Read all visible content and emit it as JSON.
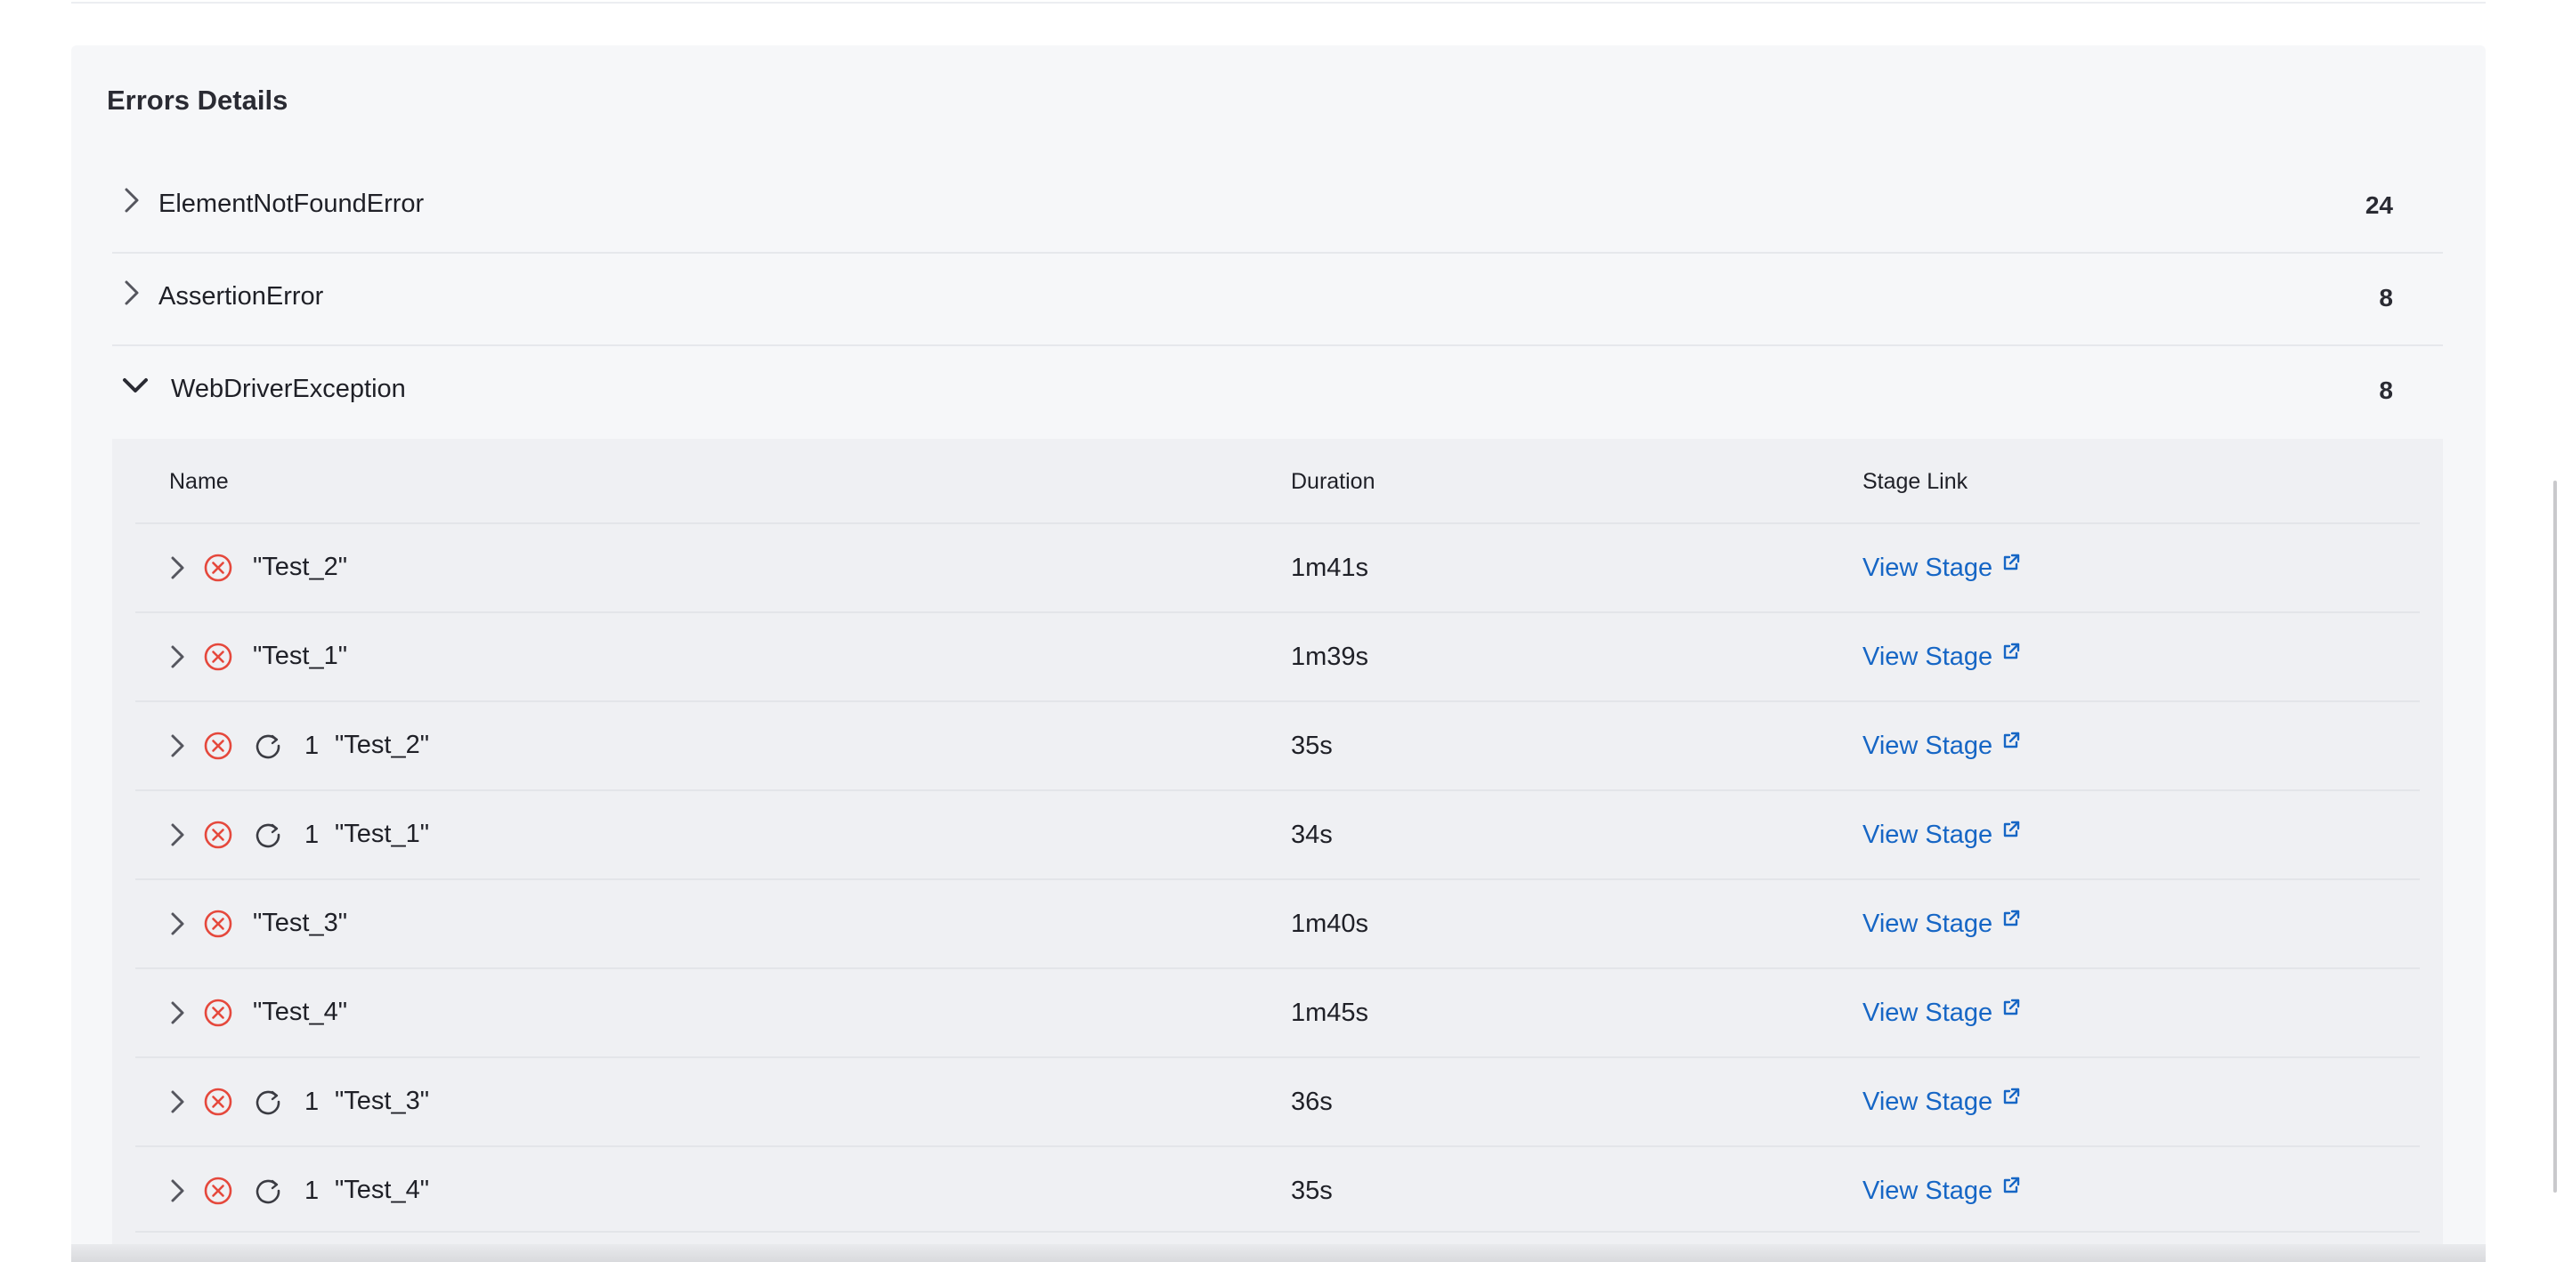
{
  "panel": {
    "title": "Errors Details"
  },
  "groups": [
    {
      "name": "ElementNotFoundError",
      "count": "24",
      "expanded": false
    },
    {
      "name": "AssertionError",
      "count": "8",
      "expanded": false
    },
    {
      "name": "WebDriverException",
      "count": "8",
      "expanded": true
    }
  ],
  "table": {
    "columns": [
      "Name",
      "Duration",
      "Stage Link"
    ],
    "rows": [
      {
        "name": "\"Test_2\"",
        "retry": "",
        "duration": "1m41s",
        "link": "View Stage"
      },
      {
        "name": "\"Test_1\"",
        "retry": "",
        "duration": "1m39s",
        "link": "View Stage"
      },
      {
        "name": "\"Test_2\"",
        "retry": "1",
        "duration": "35s",
        "link": "View Stage"
      },
      {
        "name": "\"Test_1\"",
        "retry": "1",
        "duration": "34s",
        "link": "View Stage"
      },
      {
        "name": "\"Test_3\"",
        "retry": "",
        "duration": "1m40s",
        "link": "View Stage"
      },
      {
        "name": "\"Test_4\"",
        "retry": "",
        "duration": "1m45s",
        "link": "View Stage"
      },
      {
        "name": "\"Test_3\"",
        "retry": "1",
        "duration": "36s",
        "link": "View Stage"
      },
      {
        "name": "\"Test_4\"",
        "retry": "1",
        "duration": "35s",
        "link": "View Stage"
      }
    ]
  },
  "icons": {
    "error": "error-circle-x-icon",
    "retry": "retry-icon",
    "external": "external-link-icon",
    "chevron_right": "chevron-right-icon",
    "chevron_down": "chevron-down-icon"
  },
  "colors": {
    "error": "#e5483c",
    "link": "#1666c5",
    "panel_bg": "#f6f7f9",
    "table_bg": "#eff0f3"
  }
}
